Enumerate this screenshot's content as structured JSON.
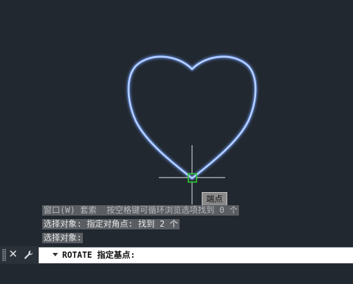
{
  "viewport": {
    "background": "#212830",
    "shape": "heart",
    "shape_color": "#7fa9ff",
    "cursor_color": "#e8e8e8",
    "snap_marker_color": "#2fd12f"
  },
  "snap_tooltip": "端点",
  "command_history": [
    "窗口(W) 套索  按空格键可循环浏览选项找到 0 个",
    "选择对象: 指定对角点: 找到 2 个",
    "选择对象:"
  ],
  "command_line": {
    "close_icon": "close-icon",
    "settings_icon": "wrench-icon",
    "prompt": "ROTATE 指定基点:",
    "value": ""
  }
}
